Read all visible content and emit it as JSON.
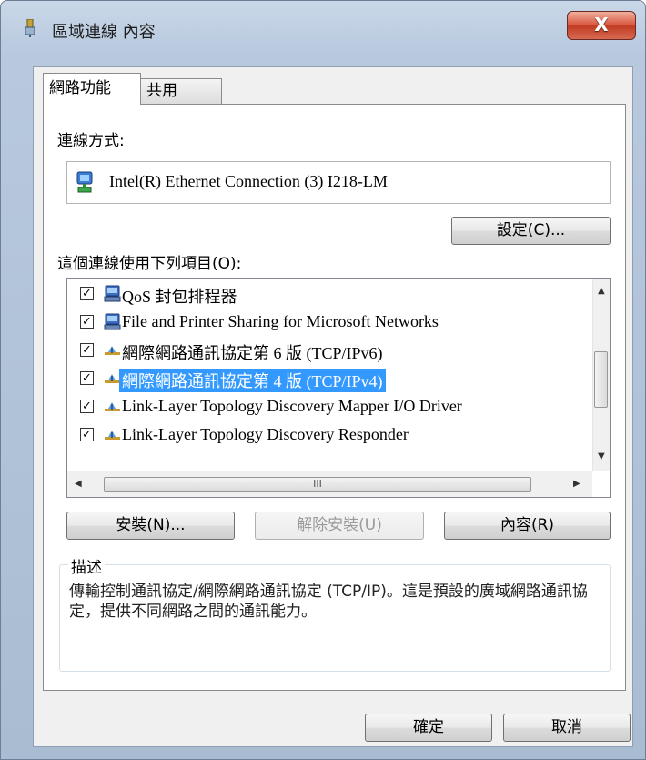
{
  "window": {
    "title": "區域連線 內容",
    "close_symbol": "X"
  },
  "tabs": [
    {
      "label": "網路功能",
      "active": true
    },
    {
      "label": "共用",
      "active": false
    }
  ],
  "connection": {
    "label": "連線方式:",
    "adapter": "Intel(R) Ethernet Connection (3) I218-LM",
    "configure_button": "設定(C)..."
  },
  "items": {
    "label": "這個連線使用下列項目(O):",
    "list": [
      {
        "text": "QoS 封包排程器",
        "checked": true,
        "icon": "network-service-icon",
        "selected": false
      },
      {
        "text": "File and Printer Sharing for Microsoft Networks",
        "checked": true,
        "icon": "network-service-icon",
        "selected": false
      },
      {
        "text": "網際網路通訊協定第 6 版 (TCP/IPv6)",
        "checked": true,
        "icon": "protocol-icon",
        "selected": false
      },
      {
        "text": "網際網路通訊協定第 4 版 (TCP/IPv4)",
        "checked": true,
        "icon": "protocol-icon",
        "selected": true
      },
      {
        "text": "Link-Layer Topology Discovery Mapper I/O Driver",
        "checked": true,
        "icon": "protocol-icon",
        "selected": false
      },
      {
        "text": "Link-Layer Topology Discovery Responder",
        "checked": true,
        "icon": "protocol-icon",
        "selected": false
      }
    ],
    "hscroll_grip": "III"
  },
  "buttons": {
    "install": "安裝(N)...",
    "uninstall": "解除安裝(U)",
    "properties": "內容(R)"
  },
  "description": {
    "title": "描述",
    "text": "傳輸控制通訊協定/網際網路通訊協定 (TCP/IP)。這是預設的廣域網路通訊協定，提供不同網路之間的通訊能力。"
  },
  "footer": {
    "ok": "確定",
    "cancel": "取消"
  },
  "colors": {
    "selection": "#3399ff",
    "close_red": "#c03b22",
    "dialog_bg": "#f0f0f0"
  }
}
